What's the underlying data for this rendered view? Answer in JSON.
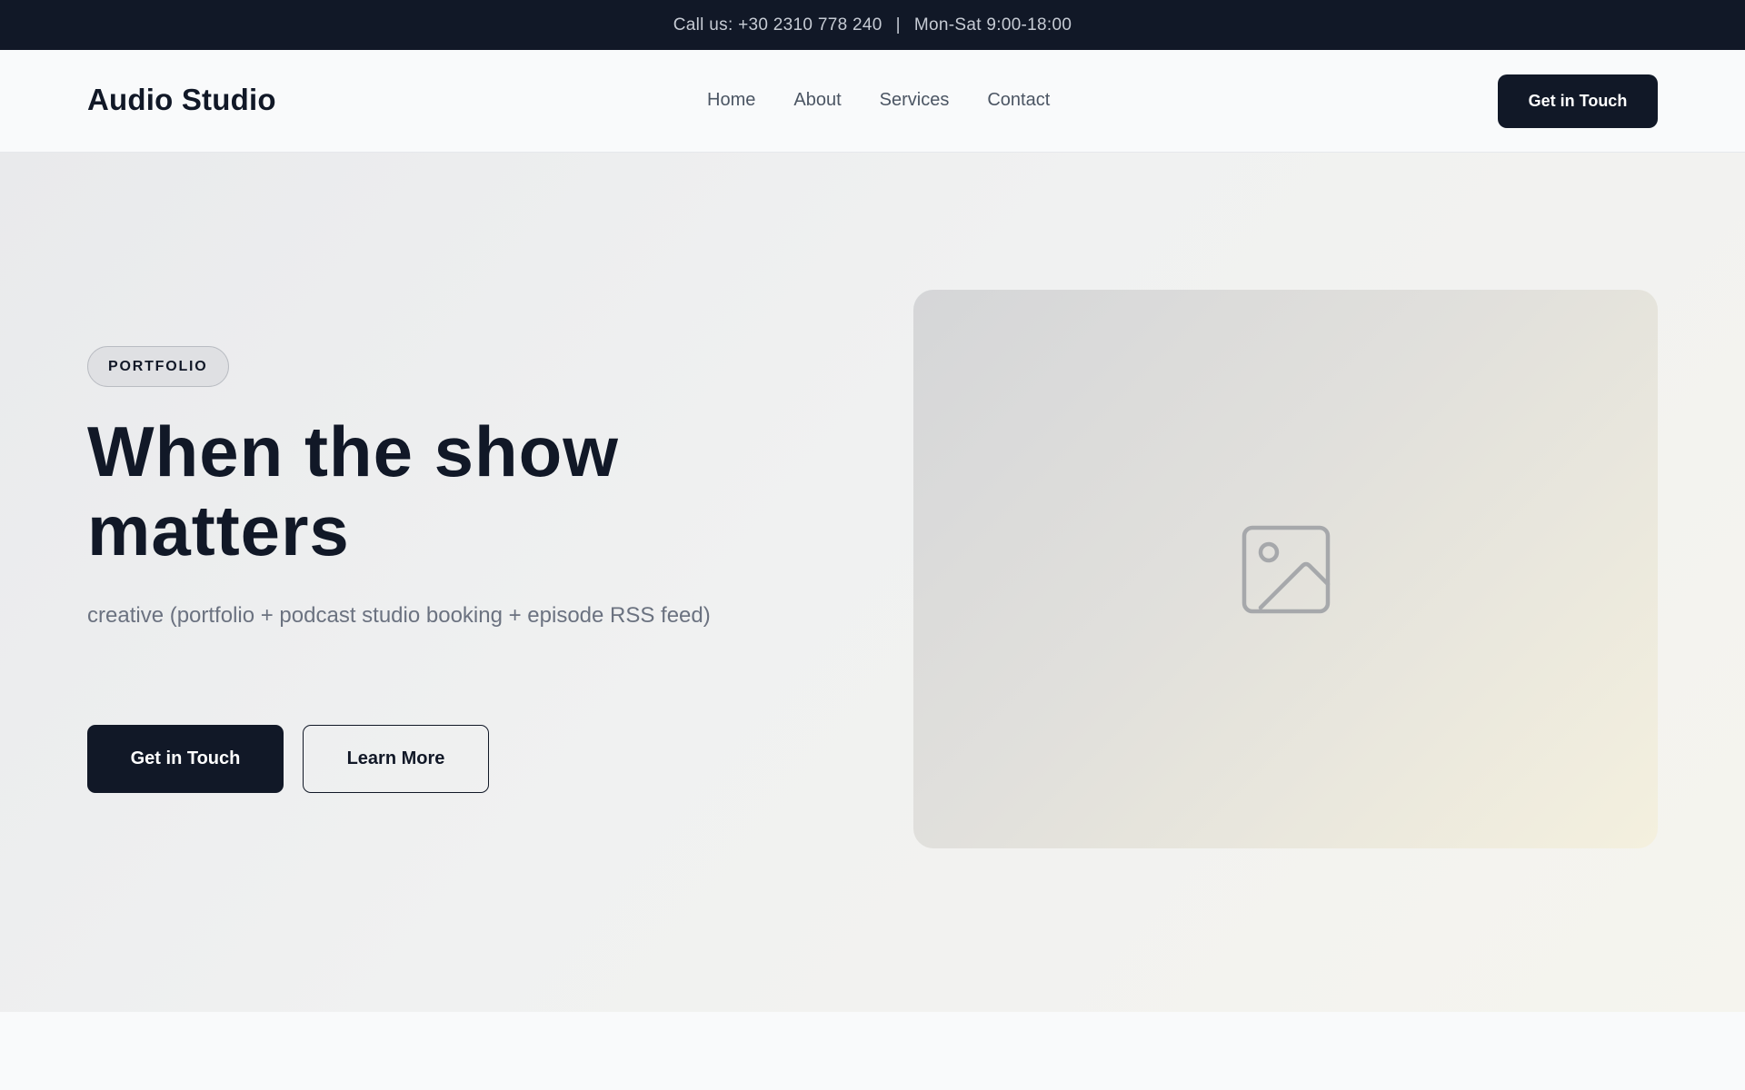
{
  "topbar": {
    "phone": "Call us: +30 2310 778 240",
    "separator": "|",
    "hours": "Mon-Sat 9:00-18:00"
  },
  "nav": {
    "brand": "Audio Studio",
    "links": [
      "Home",
      "About",
      "Services",
      "Contact"
    ],
    "cta": "Get in Touch"
  },
  "hero": {
    "badge": "PORTFOLIO",
    "title": "When the show matters",
    "subtitle": "creative (portfolio + podcast studio booking + episode RSS feed)",
    "primary_button": "Get in Touch",
    "secondary_button": "Learn More",
    "image_icon": "image-placeholder-icon"
  },
  "colors": {
    "dark": "#111827",
    "muted_text": "#6b7280",
    "nav_text": "#4b5563",
    "topbar_text": "#c6cbd4"
  }
}
